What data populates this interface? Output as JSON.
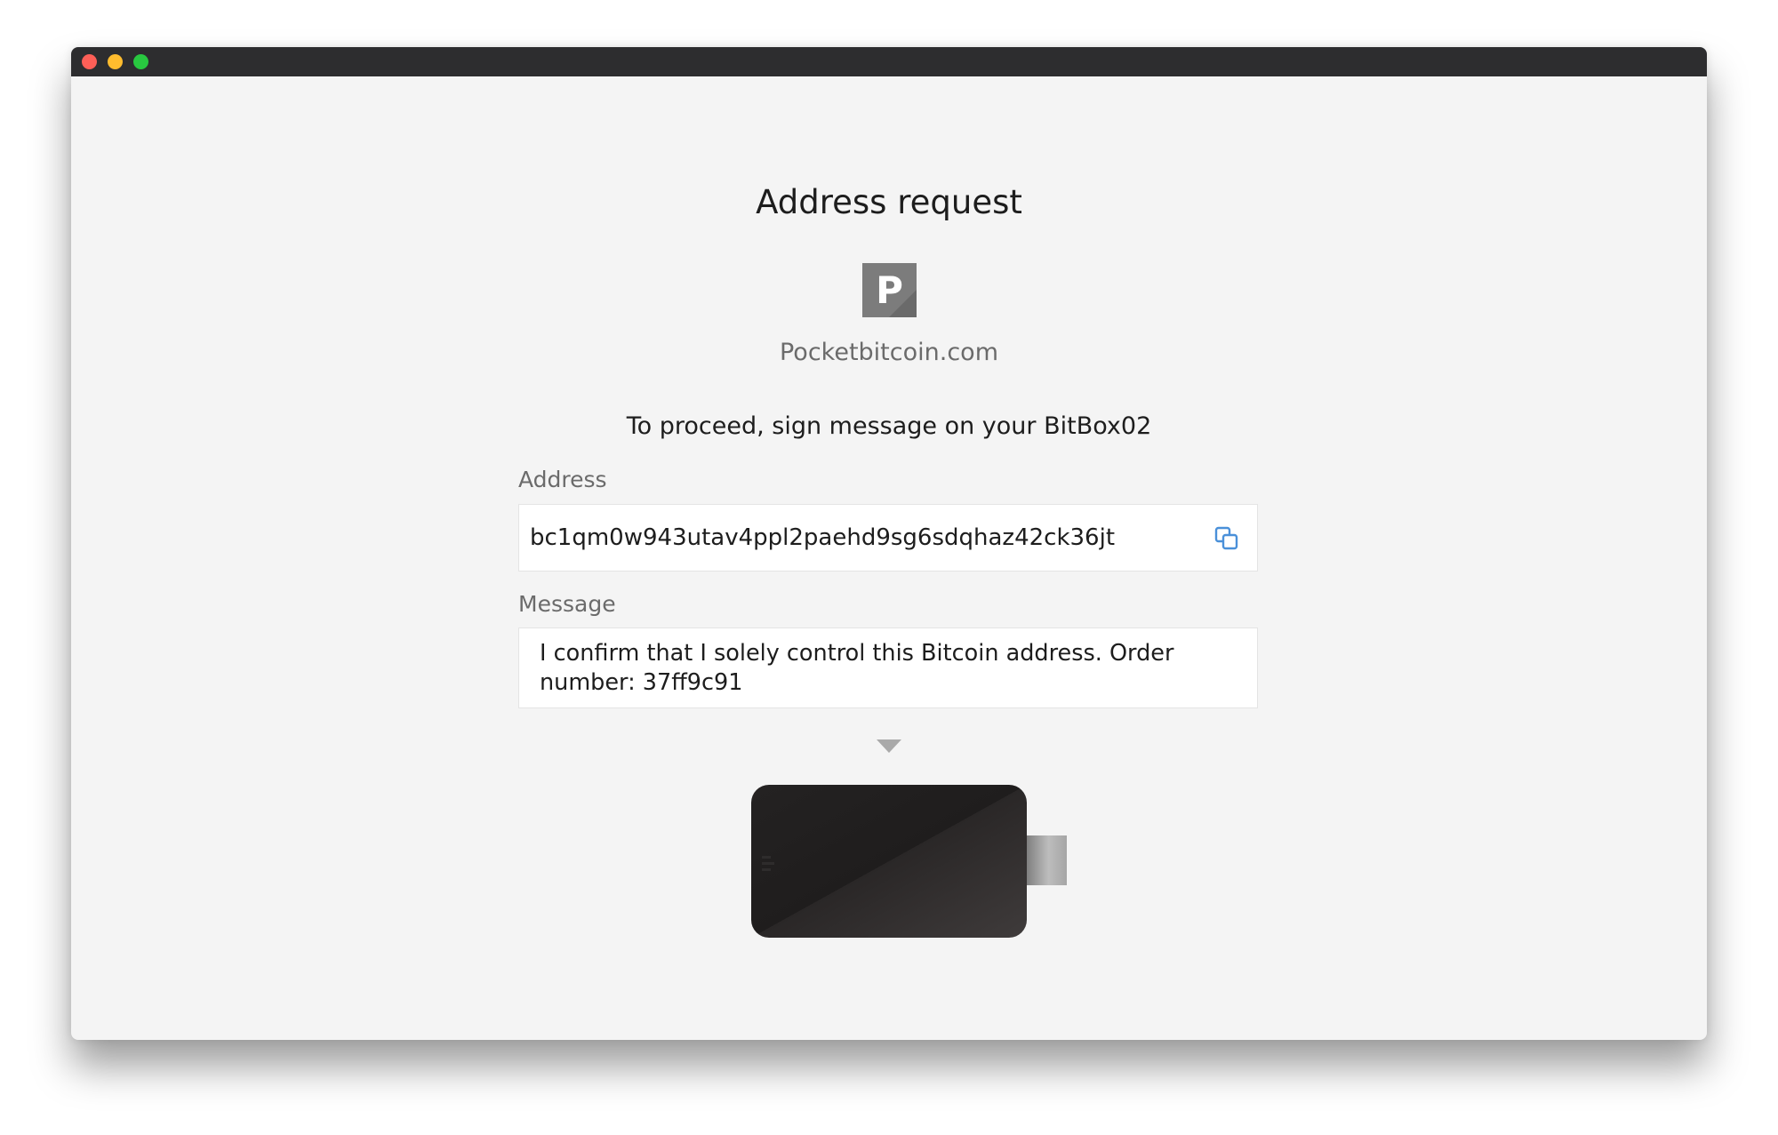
{
  "window": {
    "controls": [
      "close",
      "minimize",
      "zoom"
    ]
  },
  "page": {
    "title": "Address request",
    "site_logo_letter": "P",
    "site_logo_icon": "pocketbitcoin-logo-icon",
    "site_name": "Pocketbitcoin.com",
    "instruction": "To proceed, sign message on your BitBox02"
  },
  "address": {
    "label": "Address",
    "value": "bc1qm0w943utav4ppl2paehd9sg6sdqhaz42ck36jt",
    "copy_icon": "copy-icon"
  },
  "message": {
    "label": "Message",
    "value": "I confirm that I solely control this Bitcoin address. Order number: 37ff9c91"
  },
  "device": {
    "icon": "bitbox02-device-illustration",
    "indicator_icon": "chevron-down-icon"
  },
  "colors": {
    "titlebar": "#2d2d2f",
    "background": "#f4f4f4",
    "copy_accent": "#4a90d9",
    "logo_gray": "#7c7c7c"
  }
}
